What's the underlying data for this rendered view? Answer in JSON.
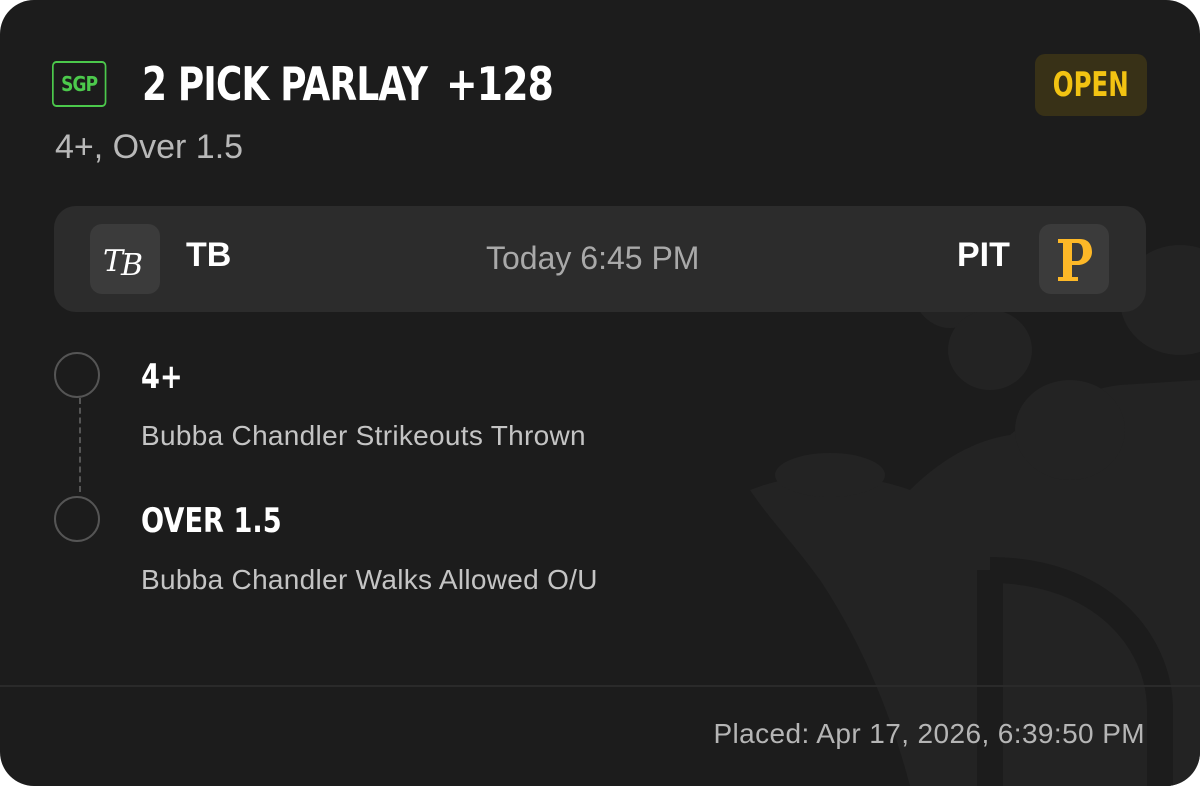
{
  "bet": {
    "badge": "SGP",
    "title": "2 PICK PARLAY",
    "odds": "+128",
    "status": "OPEN",
    "subtitle": "4+, Over 1.5"
  },
  "game": {
    "away_team": "TB",
    "away_logo_text": "TB",
    "home_team": "PIT",
    "home_logo_text": "P",
    "time": "Today 6:45 PM"
  },
  "legs": [
    {
      "title": "4+",
      "description": "Bubba Chandler Strikeouts Thrown"
    },
    {
      "title": "OVER 1.5",
      "description": "Bubba Chandler Walks Allowed O/U"
    }
  ],
  "footer": {
    "placed": "Placed: Apr 17, 2026, 6:39:50 PM"
  },
  "colors": {
    "card_bg": "#1c1c1c",
    "sgp_green": "#4cc94c",
    "open_yellow": "#f2c312",
    "pirates_gold": "#fdb827"
  },
  "icons": {
    "watermark": "crown-watermark-icon",
    "away_logo": "rays-logo-icon",
    "home_logo": "pirates-logo-icon"
  }
}
